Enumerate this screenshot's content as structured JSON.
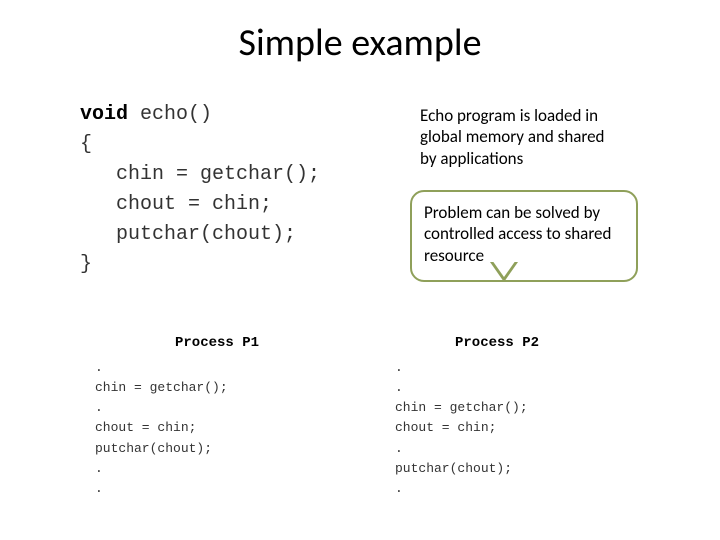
{
  "title": "Simple example",
  "code_main": {
    "l1a": "void",
    "l1b": "echo()",
    "l2": "{",
    "l3": "chin = getchar();",
    "l4": "chout = chin;",
    "l5": "putchar(chout);",
    "l6": "}"
  },
  "note1": "Echo program is loaded in global memory and shared by applications",
  "callout": "Problem can be solved by controlled access to shared resource",
  "proc1": {
    "label": "Process P1",
    "l1": ".",
    "l2": "chin = getchar();",
    "l3": ".",
    "l4": "chout = chin;",
    "l5": "putchar(chout);",
    "l6": ".",
    "l7": "."
  },
  "proc2": {
    "label": "Process P2",
    "l1": ".",
    "l2": ".",
    "l3": "chin = getchar();",
    "l4": "chout = chin;",
    "l5": ".",
    "l6": "putchar(chout);",
    "l7": "."
  }
}
